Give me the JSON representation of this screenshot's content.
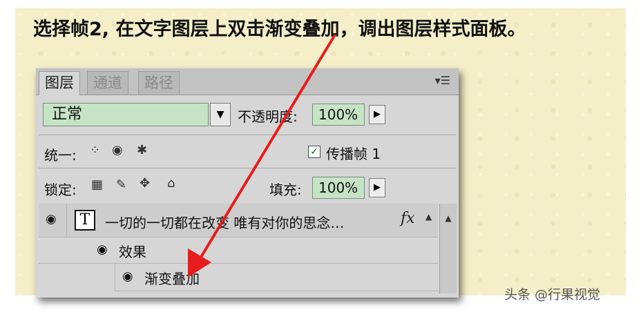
{
  "instruction": "选择帧2, 在文字图层上双击渐变叠加，调出图层样式面板。",
  "panel": {
    "tabs": [
      {
        "label": "图层"
      },
      {
        "label": "通道"
      },
      {
        "label": "路径"
      }
    ],
    "blend_mode": "正常",
    "opacity_label": "不透明度:",
    "opacity_value": "100%",
    "unify_label": "统一:",
    "propagate_label": "传播帧 1",
    "propagate_checked": "✓",
    "lock_label": "锁定:",
    "fill_label": "填充:",
    "fill_value": "100%",
    "layers": [
      {
        "name": "一切的一切都在改变 唯有对你的思念…",
        "thumb": "T",
        "fx": "fx"
      },
      {
        "name": "效果"
      },
      {
        "name": "渐变叠加"
      }
    ]
  },
  "watermark": "头条 @行果视觉",
  "colors": {
    "arrow": "#e81c1c",
    "field_green": "#c5e4c6"
  }
}
